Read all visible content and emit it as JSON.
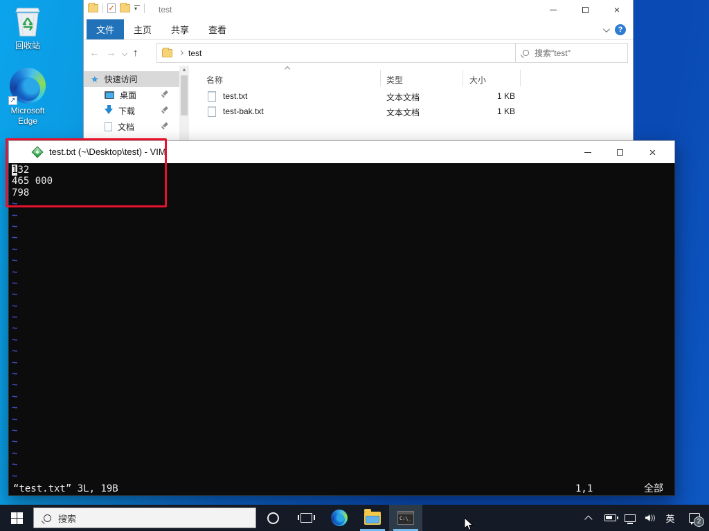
{
  "desktop": {
    "icons": [
      {
        "label": "回收站"
      },
      {
        "label1": "Microsoft",
        "label2": "Edge"
      }
    ]
  },
  "explorer": {
    "title": "test",
    "tabs": {
      "file": "文件",
      "home": "主页",
      "share": "共享",
      "view": "查看"
    },
    "address": {
      "path": "test",
      "search_placeholder": "搜索\"test\""
    },
    "help_label": "?",
    "sidebar": {
      "quick_access": "快速访问",
      "desktop": "桌面",
      "downloads": "下载",
      "documents": "文档"
    },
    "columns": {
      "name": "名称",
      "type": "类型",
      "size": "大小"
    },
    "files": [
      {
        "name": "test.txt",
        "type": "文本文档",
        "size": "1 KB"
      },
      {
        "name": "test-bak.txt",
        "type": "文本文档",
        "size": "1 KB"
      }
    ]
  },
  "vim": {
    "title": "test.txt (~\\Desktop\\test) - VIM",
    "line1_cursor_char": "1",
    "line1_rest": "32",
    "line2": "465 000",
    "line3": "798",
    "tilde": "~",
    "tilde_count": 25,
    "status": {
      "left": "“test.txt” 3L, 19B",
      "position": "1,1",
      "scroll": "全部"
    }
  },
  "annotation": {
    "color": "#e8112d"
  },
  "taskbar": {
    "search_placeholder": "搜索",
    "console_icon_text": "C:\\_",
    "ime_indicator": "英",
    "notification_badge": "2"
  }
}
